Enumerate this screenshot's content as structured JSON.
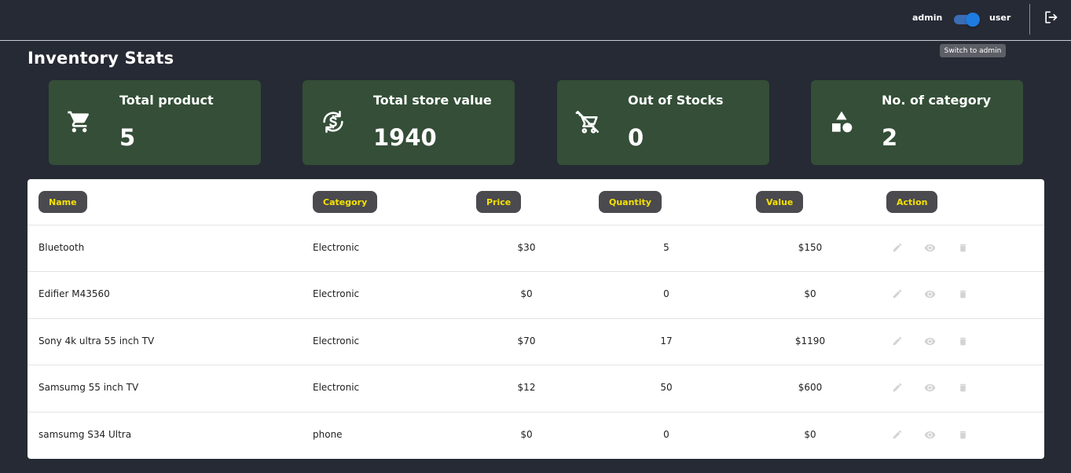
{
  "header": {
    "role_left": "admin",
    "role_right": "user",
    "tooltip": "Switch to admin",
    "icons": {
      "logout": "logout-icon"
    }
  },
  "page": {
    "title": "Inventory Stats"
  },
  "stats": [
    {
      "label": "Total product",
      "value": "5",
      "icon": "cart-icon"
    },
    {
      "label": "Total store value",
      "value": "1940",
      "icon": "currency-exchange-icon"
    },
    {
      "label": "Out of Stocks",
      "value": "0",
      "icon": "remove-cart-icon"
    },
    {
      "label": "No. of category",
      "value": "2",
      "icon": "category-shapes-icon"
    }
  ],
  "table": {
    "headers": [
      "Name",
      "Category",
      "Price",
      "Quantity",
      "Value",
      "Action"
    ],
    "rows": [
      {
        "name": "Bluetooth",
        "category": "Electronic",
        "price": "$30",
        "quantity": "5",
        "value": "$150"
      },
      {
        "name": "Edifier M43560",
        "category": "Electronic",
        "price": "$0",
        "quantity": "0",
        "value": "$0"
      },
      {
        "name": "Sony 4k ultra 55 inch TV",
        "category": "Electronic",
        "price": "$70",
        "quantity": "17",
        "value": "$1190"
      },
      {
        "name": "Samsumg 55 inch TV",
        "category": "Electronic",
        "price": "$12",
        "quantity": "50",
        "value": "$600"
      },
      {
        "name": "samsumg S34 Ultra",
        "category": "phone",
        "price": "$0",
        "quantity": "0",
        "value": "$0"
      }
    ],
    "action_icons": [
      "edit-icon",
      "view-icon",
      "delete-icon"
    ]
  },
  "colors": {
    "background": "#262a34",
    "card": "#344e37",
    "header_pill": "#4a4a4f",
    "header_text": "#f5e100",
    "toggle": "#1e7be0"
  }
}
